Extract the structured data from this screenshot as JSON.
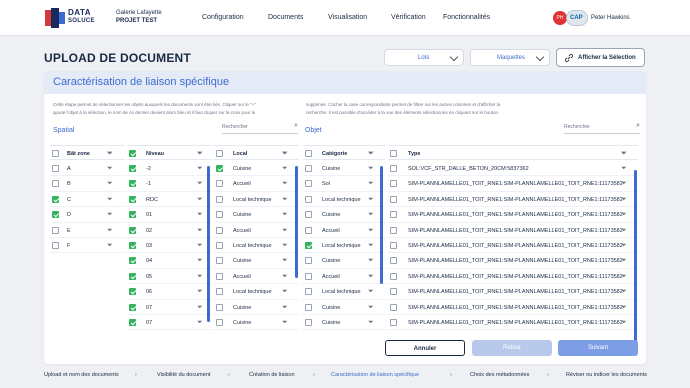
{
  "app": {
    "logo_line1": "DATA",
    "logo_line2": "SOLUCE",
    "project_line1": "Galerie Lafayette",
    "project_line2": "PROJET TEST",
    "user": "Peter Hawkins"
  },
  "nav": [
    "Configuration",
    "Documents",
    "Visualisation",
    "Vérification",
    "Fonctionnalités"
  ],
  "page_title": "UPLOAD DE DOCUMENT",
  "dropdowns": {
    "lots": "Lots",
    "maquettes": "Maquettes"
  },
  "afficher_button": "Afficher la Sélection",
  "card_title": "Caractérisation de liaison spécifique",
  "description_left": "Cette étape permet de sélectionner les objets auxquels les documents vont être liés. Cliquer sur le \"+\"\najoute l'objet à la sélection, le nom de ce dernier devient alors bleu et il faut cliquer sur la croix pour le",
  "description_right": "supprimer. Cocher la case correspondante permet de filtrer sur les autres colonnes et d'afficher la\nrecherche. Il est possible d'accéder à la vue des éléments sélectionnés en cliquant sur le bouton",
  "spatial": {
    "title": "Spatial",
    "search_placeholder": "Rechercher"
  },
  "objet": {
    "title": "Objet",
    "search_placeholder": "Rechercher"
  },
  "columns": {
    "batiment": "Bât zone",
    "niveau": "Niveau",
    "local": "Local",
    "categorie": "Catégorie",
    "type": "Type"
  },
  "batiment_rows": [
    {
      "label": "A",
      "checked": false
    },
    {
      "label": "B",
      "checked": false
    },
    {
      "label": "C",
      "checked": true
    },
    {
      "label": "D",
      "checked": true
    },
    {
      "label": "E",
      "checked": false
    },
    {
      "label": "F",
      "checked": false
    }
  ],
  "niveau_rows": [
    {
      "label": "-2",
      "checked": true
    },
    {
      "label": "-1",
      "checked": true
    },
    {
      "label": "RDC",
      "checked": true
    },
    {
      "label": "01",
      "checked": true
    },
    {
      "label": "02",
      "checked": true
    },
    {
      "label": "03",
      "checked": true
    },
    {
      "label": "04",
      "checked": true
    },
    {
      "label": "05",
      "checked": true
    },
    {
      "label": "06",
      "checked": true
    },
    {
      "label": "07",
      "checked": true
    },
    {
      "label": "07",
      "checked": true
    }
  ],
  "local_rows": [
    {
      "label": "Cuisine",
      "checked": true
    },
    {
      "label": "Accueil",
      "checked": false
    },
    {
      "label": "Local technique",
      "checked": false
    },
    {
      "label": "Cuisine",
      "checked": false
    },
    {
      "label": "Accueil",
      "checked": false
    },
    {
      "label": "Local technique",
      "checked": false
    },
    {
      "label": "Cuisine",
      "checked": false
    },
    {
      "label": "Accueil",
      "checked": false
    },
    {
      "label": "Local technique",
      "checked": false
    },
    {
      "label": "Cuisine",
      "checked": false
    },
    {
      "label": "Cuisine",
      "checked": false
    }
  ],
  "categorie_rows": [
    {
      "label": "Cuisine",
      "checked": false
    },
    {
      "label": "Sol",
      "checked": false
    },
    {
      "label": "Local technique",
      "checked": false
    },
    {
      "label": "Cuisine",
      "checked": false
    },
    {
      "label": "Accueil",
      "checked": false
    },
    {
      "label": "Local technique",
      "checked": true
    },
    {
      "label": "Cuisine",
      "checked": false
    },
    {
      "label": "Accueil",
      "checked": false
    },
    {
      "label": "Local technique",
      "checked": false
    },
    {
      "label": "Cuisine",
      "checked": false
    },
    {
      "label": "Cuisine",
      "checked": false
    }
  ],
  "type_rows": [
    {
      "label": "SOL:VCF_STR_DALLE_BETON_20CM:5837362",
      "checked": false
    },
    {
      "label": "SIM-PLANNLAMELLE01_TOIT_RNE1:SIM-PLANNLAMELLE01_TOIT_RNE1:11173582",
      "checked": false
    },
    {
      "label": "SIM-PLANNLAMELLE01_TOIT_RNE1:SIM-PLANNLAMELLE01_TOIT_RNE1:11173582",
      "checked": false
    },
    {
      "label": "SIM-PLANNLAMELLE01_TOIT_RNE1:SIM-PLANNLAMELLE01_TOIT_RNE1:11173582",
      "checked": false
    },
    {
      "label": "SIM-PLANNLAMELLE01_TOIT_RNE1:SIM-PLANNLAMELLE01_TOIT_RNE1:11173582",
      "checked": false
    },
    {
      "label": "SIM-PLANNLAMELLE01_TOIT_RNE1:SIM-PLANNLAMELLE01_TOIT_RNE1:11173582",
      "checked": false
    },
    {
      "label": "SIM-PLANNLAMELLE01_TOIT_RNE1:SIM-PLANNLAMELLE01_TOIT_RNE1:11173582",
      "checked": false
    },
    {
      "label": "SIM-PLANNLAMELLE01_TOIT_RNE1:SIM-PLANNLAMELLE01_TOIT_RNE1:11173582",
      "checked": false
    },
    {
      "label": "SIM-PLANNLAMELLE01_TOIT_RNE1:SIM-PLANNLAMELLE01_TOIT_RNE1:11173582",
      "checked": false
    },
    {
      "label": "SIM-PLANNLAMELLE01_TOIT_RNE1:SIM-PLANNLAMELLE01_TOIT_RNE1:11173582",
      "checked": false
    },
    {
      "label": "SIM-PLANNLAMELLE01_TOIT_RNE1:SIM-PLANNLAMELLE01_TOIT_RNE1:11173582",
      "checked": false
    }
  ],
  "buttons": {
    "annuler": "Annuler",
    "retour": "Retour",
    "suivant": "Suivant"
  },
  "breadcrumb": [
    "Upload et nom des documents",
    "Visibilité du document",
    "Création de liaison",
    "Caractérisation de liaison spécifique",
    "Choix des métadonnées",
    "Réviser ou indicer les documents"
  ],
  "active_step": 3,
  "colors": {
    "accent": "#3d6bd1",
    "check": "#35b35e",
    "logo_blue": "#1a2a5c",
    "logo_red": "#d33a3a"
  },
  "icons": {
    "filter": "funnel-icon",
    "search": "search-icon",
    "chevron": "chevron-down-icon",
    "afficher": "link-icon",
    "logo": "data-soluce-logo"
  }
}
